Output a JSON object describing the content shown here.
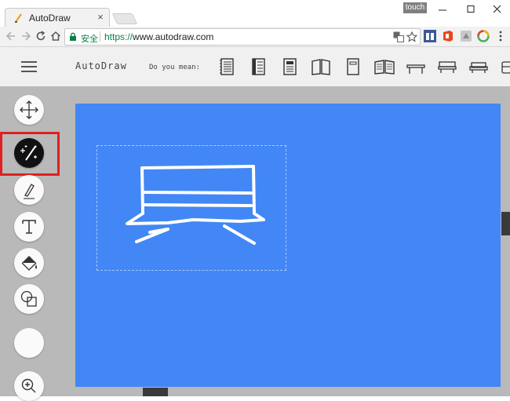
{
  "browser": {
    "tab_title": "AutoDraw",
    "tab_close": "×",
    "profile_badge": "touch",
    "secure_label": "安全",
    "url_scheme": "https://",
    "url_host": "www.autodraw.com"
  },
  "app": {
    "title": "AutoDraw",
    "suggestions_label": "Do you mean:",
    "suggestion_icons": [
      "notebook-icon",
      "notebook-icon",
      "notebook-icon",
      "open-book-icon",
      "book-icon",
      "open-book-icon",
      "table-icon",
      "bench-icon",
      "sofa-icon",
      "partial-icon"
    ]
  },
  "tools": [
    "move-icon",
    "autodraw-icon",
    "pencil-icon",
    "text-icon",
    "fill-icon",
    "shape-icon",
    "color-swatch",
    "zoom-icon"
  ],
  "colors": {
    "canvas": "#4287f5",
    "workspace": "#b9b9b9",
    "highlight": "#e02020",
    "stroke": "#ffffff"
  }
}
